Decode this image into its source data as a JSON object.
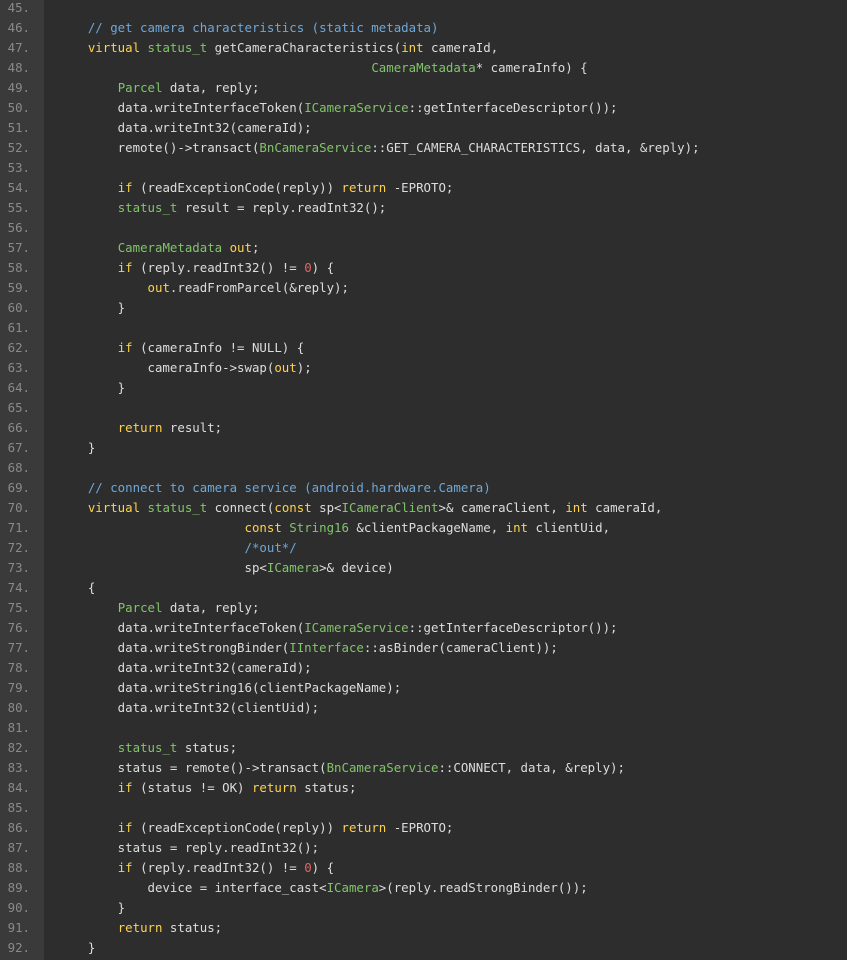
{
  "colors": {
    "background": "#2d2d2d",
    "gutter": "#3a3a3a",
    "line_number": "#8a8a8a",
    "plain": "#dddddd",
    "keyword": "#ffd24a",
    "type": "#82c46a",
    "comment": "#6fa7d8",
    "number": "#e56464"
  },
  "code_lines": [
    {
      "n": "45.",
      "tokens": []
    },
    {
      "n": "46.",
      "tokens": [
        [
          "c",
          "    // get camera characteristics (static metadata)"
        ]
      ]
    },
    {
      "n": "47.",
      "tokens": [
        [
          "p",
          "    "
        ],
        [
          "k",
          "virtual"
        ],
        [
          "p",
          " "
        ],
        [
          "t",
          "status_t"
        ],
        [
          "p",
          " getCameraCharacteristics("
        ],
        [
          "k",
          "int"
        ],
        [
          "p",
          " cameraId,"
        ]
      ]
    },
    {
      "n": "48.",
      "tokens": [
        [
          "p",
          "                                          "
        ],
        [
          "t",
          "CameraMetadata"
        ],
        [
          "p",
          "* cameraInfo) {"
        ]
      ]
    },
    {
      "n": "49.",
      "tokens": [
        [
          "p",
          "        "
        ],
        [
          "t",
          "Parcel"
        ],
        [
          "p",
          " data, reply;"
        ]
      ]
    },
    {
      "n": "50.",
      "tokens": [
        [
          "p",
          "        data.writeInterfaceToken("
        ],
        [
          "t",
          "ICameraService"
        ],
        [
          "p",
          "::getInterfaceDescriptor());"
        ]
      ]
    },
    {
      "n": "51.",
      "tokens": [
        [
          "p",
          "        data.writeInt32(cameraId);"
        ]
      ]
    },
    {
      "n": "52.",
      "tokens": [
        [
          "p",
          "        remote()->transact("
        ],
        [
          "t",
          "BnCameraService"
        ],
        [
          "p",
          "::GET_CAMERA_CHARACTERISTICS, data, &reply);"
        ]
      ]
    },
    {
      "n": "53.",
      "tokens": []
    },
    {
      "n": "54.",
      "tokens": [
        [
          "p",
          "        "
        ],
        [
          "k",
          "if"
        ],
        [
          "p",
          " (readExceptionCode(reply)) "
        ],
        [
          "k",
          "return"
        ],
        [
          "p",
          " -EPROTO;"
        ]
      ]
    },
    {
      "n": "55.",
      "tokens": [
        [
          "p",
          "        "
        ],
        [
          "t",
          "status_t"
        ],
        [
          "p",
          " result = reply.readInt32();"
        ]
      ]
    },
    {
      "n": "56.",
      "tokens": []
    },
    {
      "n": "57.",
      "tokens": [
        [
          "p",
          "        "
        ],
        [
          "t",
          "CameraMetadata"
        ],
        [
          "p",
          " "
        ],
        [
          "k",
          "out"
        ],
        [
          "p",
          ";"
        ]
      ]
    },
    {
      "n": "58.",
      "tokens": [
        [
          "p",
          "        "
        ],
        [
          "k",
          "if"
        ],
        [
          "p",
          " (reply.readInt32() != "
        ],
        [
          "n",
          "0"
        ],
        [
          "p",
          ") {"
        ]
      ]
    },
    {
      "n": "59.",
      "tokens": [
        [
          "p",
          "            "
        ],
        [
          "k",
          "out"
        ],
        [
          "p",
          ".readFromParcel(&reply);"
        ]
      ]
    },
    {
      "n": "60.",
      "tokens": [
        [
          "p",
          "        }"
        ]
      ]
    },
    {
      "n": "61.",
      "tokens": []
    },
    {
      "n": "62.",
      "tokens": [
        [
          "p",
          "        "
        ],
        [
          "k",
          "if"
        ],
        [
          "p",
          " (cameraInfo != NULL) {"
        ]
      ]
    },
    {
      "n": "63.",
      "tokens": [
        [
          "p",
          "            cameraInfo->swap("
        ],
        [
          "k",
          "out"
        ],
        [
          "p",
          ");"
        ]
      ]
    },
    {
      "n": "64.",
      "tokens": [
        [
          "p",
          "        }"
        ]
      ]
    },
    {
      "n": "65.",
      "tokens": []
    },
    {
      "n": "66.",
      "tokens": [
        [
          "p",
          "        "
        ],
        [
          "k",
          "return"
        ],
        [
          "p",
          " result;"
        ]
      ]
    },
    {
      "n": "67.",
      "tokens": [
        [
          "p",
          "    }"
        ]
      ]
    },
    {
      "n": "68.",
      "tokens": []
    },
    {
      "n": "69.",
      "tokens": [
        [
          "c",
          "    // connect to camera service (android.hardware.Camera)"
        ]
      ]
    },
    {
      "n": "70.",
      "tokens": [
        [
          "p",
          "    "
        ],
        [
          "k",
          "virtual"
        ],
        [
          "p",
          " "
        ],
        [
          "t",
          "status_t"
        ],
        [
          "p",
          " connect("
        ],
        [
          "k",
          "const"
        ],
        [
          "p",
          " sp<"
        ],
        [
          "t",
          "ICameraClient"
        ],
        [
          "p",
          ">& cameraClient, "
        ],
        [
          "k",
          "int"
        ],
        [
          "p",
          " cameraId,"
        ]
      ]
    },
    {
      "n": "71.",
      "tokens": [
        [
          "p",
          "                         "
        ],
        [
          "k",
          "const"
        ],
        [
          "p",
          " "
        ],
        [
          "t",
          "String16"
        ],
        [
          "p",
          " &clientPackageName, "
        ],
        [
          "k",
          "int"
        ],
        [
          "p",
          " clientUid,"
        ]
      ]
    },
    {
      "n": "72.",
      "tokens": [
        [
          "p",
          "                         "
        ],
        [
          "c",
          "/*out*/"
        ]
      ]
    },
    {
      "n": "73.",
      "tokens": [
        [
          "p",
          "                         sp<"
        ],
        [
          "t",
          "ICamera"
        ],
        [
          "p",
          ">& device)"
        ]
      ]
    },
    {
      "n": "74.",
      "tokens": [
        [
          "p",
          "    {"
        ]
      ]
    },
    {
      "n": "75.",
      "tokens": [
        [
          "p",
          "        "
        ],
        [
          "t",
          "Parcel"
        ],
        [
          "p",
          " data, reply;"
        ]
      ]
    },
    {
      "n": "76.",
      "tokens": [
        [
          "p",
          "        data.writeInterfaceToken("
        ],
        [
          "t",
          "ICameraService"
        ],
        [
          "p",
          "::getInterfaceDescriptor());"
        ]
      ]
    },
    {
      "n": "77.",
      "tokens": [
        [
          "p",
          "        data.writeStrongBinder("
        ],
        [
          "t",
          "IInterface"
        ],
        [
          "p",
          "::asBinder(cameraClient));"
        ]
      ]
    },
    {
      "n": "78.",
      "tokens": [
        [
          "p",
          "        data.writeInt32(cameraId);"
        ]
      ]
    },
    {
      "n": "79.",
      "tokens": [
        [
          "p",
          "        data.writeString16(clientPackageName);"
        ]
      ]
    },
    {
      "n": "80.",
      "tokens": [
        [
          "p",
          "        data.writeInt32(clientUid);"
        ]
      ]
    },
    {
      "n": "81.",
      "tokens": []
    },
    {
      "n": "82.",
      "tokens": [
        [
          "p",
          "        "
        ],
        [
          "t",
          "status_t"
        ],
        [
          "p",
          " status;"
        ]
      ]
    },
    {
      "n": "83.",
      "tokens": [
        [
          "p",
          "        status = remote()->transact("
        ],
        [
          "t",
          "BnCameraService"
        ],
        [
          "p",
          "::CONNECT, data, &reply);"
        ]
      ]
    },
    {
      "n": "84.",
      "tokens": [
        [
          "p",
          "        "
        ],
        [
          "k",
          "if"
        ],
        [
          "p",
          " (status != OK) "
        ],
        [
          "k",
          "return"
        ],
        [
          "p",
          " status;"
        ]
      ]
    },
    {
      "n": "85.",
      "tokens": []
    },
    {
      "n": "86.",
      "tokens": [
        [
          "p",
          "        "
        ],
        [
          "k",
          "if"
        ],
        [
          "p",
          " (readExceptionCode(reply)) "
        ],
        [
          "k",
          "return"
        ],
        [
          "p",
          " -EPROTO;"
        ]
      ]
    },
    {
      "n": "87.",
      "tokens": [
        [
          "p",
          "        status = reply.readInt32();"
        ]
      ]
    },
    {
      "n": "88.",
      "tokens": [
        [
          "p",
          "        "
        ],
        [
          "k",
          "if"
        ],
        [
          "p",
          " (reply.readInt32() != "
        ],
        [
          "n",
          "0"
        ],
        [
          "p",
          ") {"
        ]
      ]
    },
    {
      "n": "89.",
      "tokens": [
        [
          "p",
          "            device = interface_cast<"
        ],
        [
          "t",
          "ICamera"
        ],
        [
          "p",
          ">(reply.readStrongBinder());"
        ]
      ]
    },
    {
      "n": "90.",
      "tokens": [
        [
          "p",
          "        }"
        ]
      ]
    },
    {
      "n": "91.",
      "tokens": [
        [
          "p",
          "        "
        ],
        [
          "k",
          "return"
        ],
        [
          "p",
          " status;"
        ]
      ]
    },
    {
      "n": "92.",
      "tokens": [
        [
          "p",
          "    }"
        ]
      ]
    }
  ]
}
